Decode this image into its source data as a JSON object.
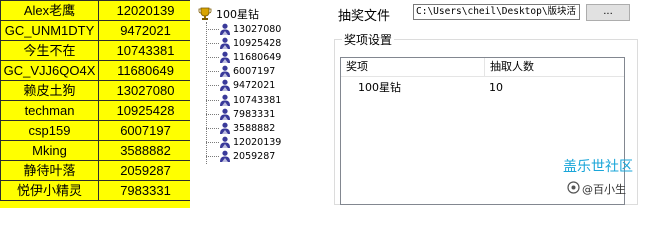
{
  "sheet": {
    "rows": [
      {
        "name": "Alex老鹰",
        "id": "12020139"
      },
      {
        "name": "GC_UNM1DTY",
        "id": "9472021"
      },
      {
        "name": "今生不在",
        "id": "10743381"
      },
      {
        "name": "GC_VJJ6QO4X",
        "id": "11680649"
      },
      {
        "name": "赖皮土狗",
        "id": "13027080"
      },
      {
        "name": "techman",
        "id": "10925428"
      },
      {
        "name": "csp159",
        "id": "6007197"
      },
      {
        "name": "Mking",
        "id": "3588882"
      },
      {
        "name": "静待叶落",
        "id": "2059287"
      },
      {
        "name": "悦伊小精灵",
        "id": "7983331"
      }
    ]
  },
  "tree": {
    "root_label": "100星钻",
    "items": [
      "13027080",
      "10925428",
      "11680649",
      "6007197",
      "9472021",
      "10743381",
      "7983331",
      "3588882",
      "12020139",
      "2059287"
    ]
  },
  "dialog": {
    "file_label": "抽奖文件",
    "file_path": "C:\\Users\\cheil\\Desktop\\版块活",
    "browse_label": "...",
    "group_title": "奖项设置",
    "columns": [
      "奖项",
      "抽取人数"
    ],
    "rows": [
      {
        "prize": "100星钻",
        "count": "10"
      }
    ]
  },
  "watermark": {
    "text": "盖乐世社区",
    "handle": "@百小生"
  },
  "colors": {
    "sheet_bg": "#ffff00",
    "grid": "#2d2d2d",
    "watermark": "#1aa6d9"
  }
}
